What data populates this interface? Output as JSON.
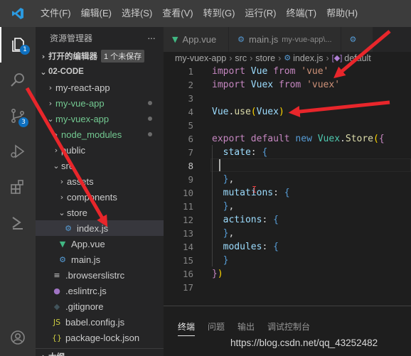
{
  "menubar": {
    "logo": "vscode-logo",
    "items": [
      "文件(F)",
      "编辑(E)",
      "选择(S)",
      "查看(V)",
      "转到(G)",
      "运行(R)",
      "终端(T)",
      "帮助(H)"
    ]
  },
  "activity": {
    "explorer_badge": "1",
    "scm_badge": "3"
  },
  "sidebar": {
    "title": "资源管理器",
    "more": "···",
    "open_editors": "打开的编辑器",
    "unsaved": "1 个未保存",
    "workspace": "02-CODE",
    "tree": [
      {
        "label": "my-react-app",
        "twisty": "›",
        "icon": "",
        "color": "#cccccc",
        "indent": 14,
        "dot": false
      },
      {
        "label": "my-vue-app",
        "twisty": "›",
        "icon": "",
        "color": "#73c991",
        "indent": 14,
        "dot": true
      },
      {
        "label": "my-vuex-app",
        "twisty": "⌄",
        "icon": "",
        "color": "#73c991",
        "indent": 14,
        "dot": true
      },
      {
        "label": "node_modules",
        "twisty": "›",
        "icon": "",
        "color": "#73c991",
        "indent": 22,
        "dot": true
      },
      {
        "label": "public",
        "twisty": "›",
        "icon": "",
        "color": "#cccccc",
        "indent": 22,
        "dot": false
      },
      {
        "label": "src",
        "twisty": "⌄",
        "icon": "",
        "color": "#cccccc",
        "indent": 22,
        "dot": false
      },
      {
        "label": "assets",
        "twisty": "›",
        "icon": "",
        "color": "#cccccc",
        "indent": 30,
        "dot": false
      },
      {
        "label": "components",
        "twisty": "›",
        "icon": "",
        "color": "#cccccc",
        "indent": 30,
        "dot": false
      },
      {
        "label": "store",
        "twisty": "⌄",
        "icon": "",
        "color": "#cccccc",
        "indent": 30,
        "dot": false
      },
      {
        "label": "index.js",
        "twisty": "",
        "icon": "⚙",
        "icon_color": "#569cd6",
        "color": "#cccccc",
        "indent": 38,
        "dot": false,
        "selected": true
      },
      {
        "label": "App.vue",
        "twisty": "",
        "icon": "▼",
        "icon_color": "#41b883",
        "color": "#cccccc",
        "indent": 30,
        "dot": false
      },
      {
        "label": "main.js",
        "twisty": "",
        "icon": "⚙",
        "icon_color": "#569cd6",
        "color": "#cccccc",
        "indent": 30,
        "dot": false
      },
      {
        "label": ".browserslistrc",
        "twisty": "",
        "icon": "≡",
        "icon_color": "#cccccc",
        "color": "#cccccc",
        "indent": 22,
        "dot": false
      },
      {
        "label": ".eslintrc.js",
        "twisty": "",
        "icon": "●",
        "icon_color": "#a074c4",
        "color": "#cccccc",
        "indent": 22,
        "dot": false
      },
      {
        "label": ".gitignore",
        "twisty": "",
        "icon": "◆",
        "icon_color": "#41535b",
        "color": "#cccccc",
        "indent": 22,
        "dot": false
      },
      {
        "label": "babel.config.js",
        "twisty": "",
        "icon": "JS",
        "icon_color": "#cbcb41",
        "color": "#cccccc",
        "indent": 22,
        "dot": false
      },
      {
        "label": "package-lock.json",
        "twisty": "",
        "icon": "{}",
        "icon_color": "#cbcb41",
        "color": "#cccccc",
        "indent": 22,
        "dot": false
      }
    ],
    "outline": "大纲"
  },
  "tabs": [
    {
      "icon": "▼",
      "icon_color": "#41b883",
      "label": "App.vue",
      "sub": ""
    },
    {
      "icon": "⚙",
      "icon_color": "#569cd6",
      "label": "main.js",
      "sub": "my-vue-app\\..."
    },
    {
      "icon": "⚙",
      "icon_color": "#569cd6",
      "label": "",
      "sub": ""
    }
  ],
  "breadcrumb": {
    "parts": [
      "my-vuex-app",
      "src",
      "store",
      "index.js",
      "default"
    ]
  },
  "editor": {
    "line_numbers": [
      "1",
      "2",
      "3",
      "4",
      "5",
      "6",
      "7",
      "8",
      "9",
      "10",
      "11",
      "12",
      "13",
      "14",
      "15",
      "16",
      "17"
    ],
    "current_line": "8",
    "lines": [
      [
        [
          "k2",
          "import"
        ],
        [
          "",
          " "
        ],
        [
          "v",
          "Vue"
        ],
        [
          "",
          " "
        ],
        [
          "k2",
          "from"
        ],
        [
          "",
          " "
        ],
        [
          "s",
          "'vue'"
        ]
      ],
      [
        [
          "k2",
          "import"
        ],
        [
          "",
          " "
        ],
        [
          "v",
          "Vuex"
        ],
        [
          "",
          " "
        ],
        [
          "k2",
          "from"
        ],
        [
          "",
          " "
        ],
        [
          "s",
          "'vuex'"
        ]
      ],
      [],
      [
        [
          "v",
          "Vue"
        ],
        [
          "",
          "."
        ],
        [
          "f",
          "use"
        ],
        [
          "p",
          "("
        ],
        [
          "v",
          "Vuex"
        ],
        [
          "p",
          ")"
        ]
      ],
      [],
      [
        [
          "k2",
          "export"
        ],
        [
          "",
          " "
        ],
        [
          "k2",
          "default"
        ],
        [
          "",
          " "
        ],
        [
          "k",
          "new"
        ],
        [
          "",
          " "
        ],
        [
          "t",
          "Vuex"
        ],
        [
          "",
          "."
        ],
        [
          "f",
          "Store"
        ],
        [
          "p",
          "("
        ],
        [
          "k2",
          "{"
        ]
      ],
      [
        [
          "",
          "  "
        ],
        [
          "v",
          "state"
        ],
        [
          "",
          ": "
        ],
        [
          "k",
          "{"
        ]
      ],
      [],
      [
        [
          "",
          "  "
        ],
        [
          "k",
          "}"
        ],
        [
          "",
          ","
        ]
      ],
      [
        [
          "",
          "  "
        ],
        [
          "v",
          "mutations"
        ],
        [
          "",
          ": "
        ],
        [
          "k",
          "{"
        ]
      ],
      [
        [
          "",
          "  "
        ],
        [
          "k",
          "}"
        ],
        [
          "",
          ","
        ]
      ],
      [
        [
          "",
          "  "
        ],
        [
          "v",
          "actions"
        ],
        [
          "",
          ": "
        ],
        [
          "k",
          "{"
        ]
      ],
      [
        [
          "",
          "  "
        ],
        [
          "k",
          "}"
        ],
        [
          "",
          ","
        ]
      ],
      [
        [
          "",
          "  "
        ],
        [
          "v",
          "modules"
        ],
        [
          "",
          ": "
        ],
        [
          "k",
          "{"
        ]
      ],
      [
        [
          "",
          "  "
        ],
        [
          "k",
          "}"
        ]
      ],
      [
        [
          "k2",
          "}"
        ],
        [
          "p",
          ")"
        ]
      ],
      []
    ]
  },
  "panel": {
    "tabs": [
      "终端",
      "问题",
      "输出",
      "调试控制台"
    ],
    "watermark": "https://blog.csdn.net/qq_43252482"
  },
  "colors": {
    "accent": "#0e70c0",
    "arrow": "#e8262b"
  }
}
